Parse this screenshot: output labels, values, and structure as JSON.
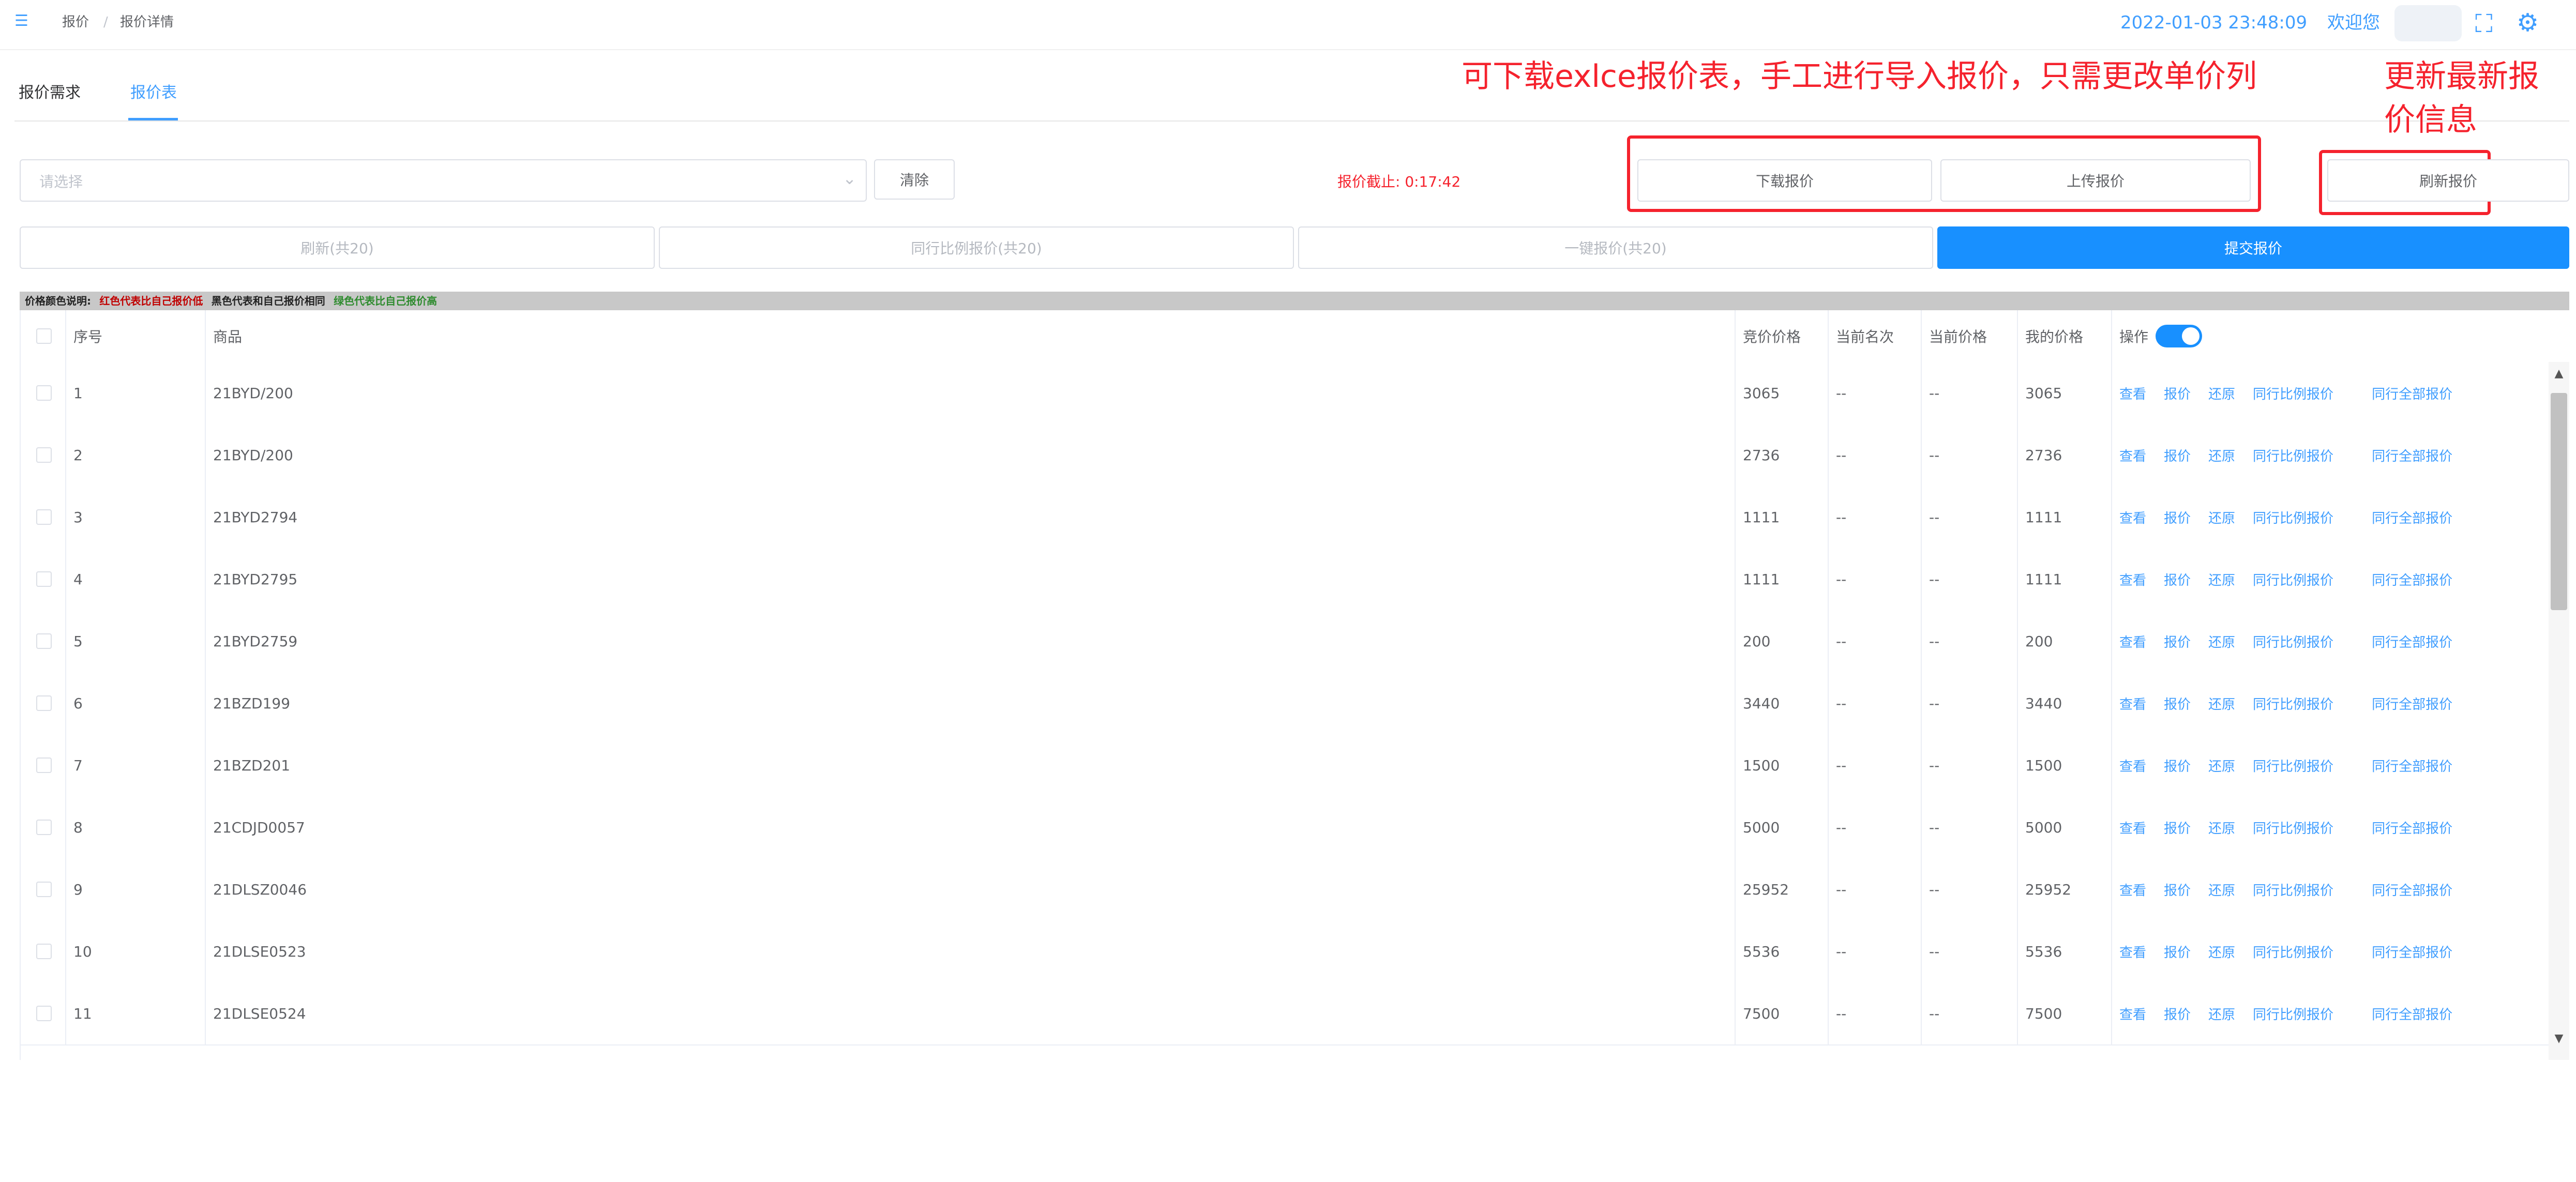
{
  "topbar": {
    "breadcrumb": [
      "报价",
      "/",
      "报价详情"
    ],
    "datetime": "2022-01-03 23:48:09",
    "user": "欢迎您"
  },
  "tabs": [
    {
      "label": "报价需求"
    },
    {
      "label": "报价表"
    }
  ],
  "toolbar": {
    "select_placeholder": "请选择",
    "clear_label": "清除",
    "deadline": "报价截止: 0:17:42",
    "download_label": "下载报价",
    "upload_label": "上传报价",
    "refresh_label": "刷新报价",
    "refresh_all_label": "刷新(共20)",
    "match_label": "同行比例报价(共20)",
    "onekey_label": "一键报价(共20)",
    "submit_label": "提交报价"
  },
  "annotations": {
    "download_note": "可下载exlce报价表，手工进行导入报价，只需更改单价列",
    "refresh_note_line1": "更新最新报",
    "refresh_note_line2": "价信息"
  },
  "legend": {
    "title": "价格颜色说明:",
    "red": "红色代表比自己报价低",
    "black": "黑色代表和自己报价相同",
    "green": "绿色代表比自己报价高"
  },
  "table": {
    "headers": {
      "index": "序号",
      "product": "商品",
      "bid_price": "竞价价格",
      "current_rank": "当前名次",
      "current_price": "当前价格",
      "my_price": "我的价格",
      "operation": "操作"
    },
    "actions": [
      "查看",
      "报价",
      "还原",
      "同行比例报价",
      "同行全部报价"
    ],
    "rows": [
      {
        "index": "1",
        "product": "21BYD/200",
        "bid": "3065",
        "rank": "--",
        "cur": "--",
        "mine": "3065"
      },
      {
        "index": "2",
        "product": "21BYD/200",
        "bid": "2736",
        "rank": "--",
        "cur": "--",
        "mine": "2736"
      },
      {
        "index": "3",
        "product": "21BYD2794",
        "bid": "1111",
        "rank": "--",
        "cur": "--",
        "mine": "1111"
      },
      {
        "index": "4",
        "product": "21BYD2795",
        "bid": "1111",
        "rank": "--",
        "cur": "--",
        "mine": "1111"
      },
      {
        "index": "5",
        "product": "21BYD2759",
        "bid": "200",
        "rank": "--",
        "cur": "--",
        "mine": "200"
      },
      {
        "index": "6",
        "product": "21BZD199",
        "bid": "3440",
        "rank": "--",
        "cur": "--",
        "mine": "3440"
      },
      {
        "index": "7",
        "product": "21BZD201",
        "bid": "1500",
        "rank": "--",
        "cur": "--",
        "mine": "1500"
      },
      {
        "index": "8",
        "product": "21CDJD0057",
        "bid": "5000",
        "rank": "--",
        "cur": "--",
        "mine": "5000"
      },
      {
        "index": "9",
        "product": "21DLSZ0046",
        "bid": "25952",
        "rank": "--",
        "cur": "--",
        "mine": "25952"
      },
      {
        "index": "10",
        "product": "21DLSE0523",
        "bid": "5536",
        "rank": "--",
        "cur": "--",
        "mine": "5536"
      },
      {
        "index": "11",
        "product": "21DLSE0524",
        "bid": "7500",
        "rank": "--",
        "cur": "--",
        "mine": "7500"
      }
    ]
  },
  "colors": {
    "primary": "#1890ff",
    "link": "#409eff",
    "annotation": "#f5222d",
    "legend_red": "#c00000",
    "legend_green": "#2e8b2e"
  },
  "icons": {
    "menu": "menu-fold-icon",
    "fullscreen": "fullscreen-icon",
    "settings": "gear-icon",
    "select": "chevron-down-icon"
  }
}
